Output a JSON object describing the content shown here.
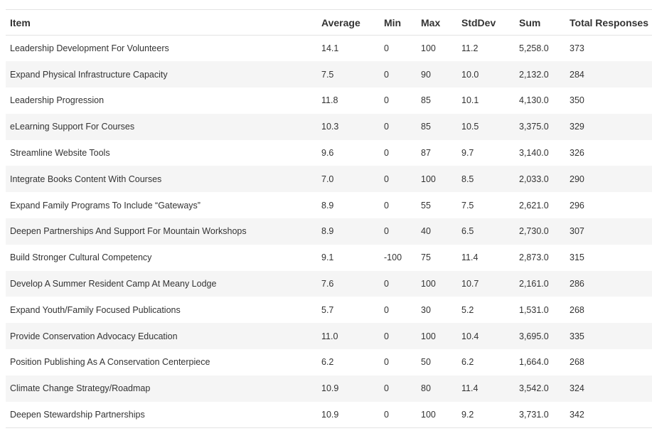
{
  "columns": [
    "Item",
    "Average",
    "Min",
    "Max",
    "StdDev",
    "Sum",
    "Total Responses"
  ],
  "rows": [
    [
      "Leadership Development For Volunteers",
      "14.1",
      "0",
      "100",
      "11.2",
      "5,258.0",
      "373"
    ],
    [
      "Expand Physical Infrastructure Capacity",
      "7.5",
      "0",
      "90",
      "10.0",
      "2,132.0",
      "284"
    ],
    [
      "Leadership Progression",
      "11.8",
      "0",
      "85",
      "10.1",
      "4,130.0",
      "350"
    ],
    [
      "eLearning Support For Courses",
      "10.3",
      "0",
      "85",
      "10.5",
      "3,375.0",
      "329"
    ],
    [
      "Streamline Website Tools",
      "9.6",
      "0",
      "87",
      "9.7",
      "3,140.0",
      "326"
    ],
    [
      "Integrate Books Content With Courses",
      "7.0",
      "0",
      "100",
      "8.5",
      "2,033.0",
      "290"
    ],
    [
      "Expand Family Programs To Include “Gateways”",
      "8.9",
      "0",
      "55",
      "7.5",
      "2,621.0",
      "296"
    ],
    [
      "Deepen Partnerships And Support For Mountain Workshops",
      "8.9",
      "0",
      "40",
      "6.5",
      "2,730.0",
      "307"
    ],
    [
      "Build Stronger Cultural Competency",
      "9.1",
      "-100",
      "75",
      "11.4",
      "2,873.0",
      "315"
    ],
    [
      "Develop A Summer Resident Camp At Meany Lodge",
      "7.6",
      "0",
      "100",
      "10.7",
      "2,161.0",
      "286"
    ],
    [
      "Expand Youth/Family Focused Publications",
      "5.7",
      "0",
      "30",
      "5.2",
      "1,531.0",
      "268"
    ],
    [
      "Provide Conservation Advocacy Education",
      "11.0",
      "0",
      "100",
      "10.4",
      "3,695.0",
      "335"
    ],
    [
      "Position Publishing As A Conservation Centerpiece",
      "6.2",
      "0",
      "50",
      "6.2",
      "1,664.0",
      "268"
    ],
    [
      "Climate Change Strategy/Roadmap",
      "10.9",
      "0",
      "80",
      "11.4",
      "3,542.0",
      "324"
    ],
    [
      "Deepen Stewardship Partnerships",
      "10.9",
      "0",
      "100",
      "9.2",
      "3,731.0",
      "342"
    ]
  ]
}
